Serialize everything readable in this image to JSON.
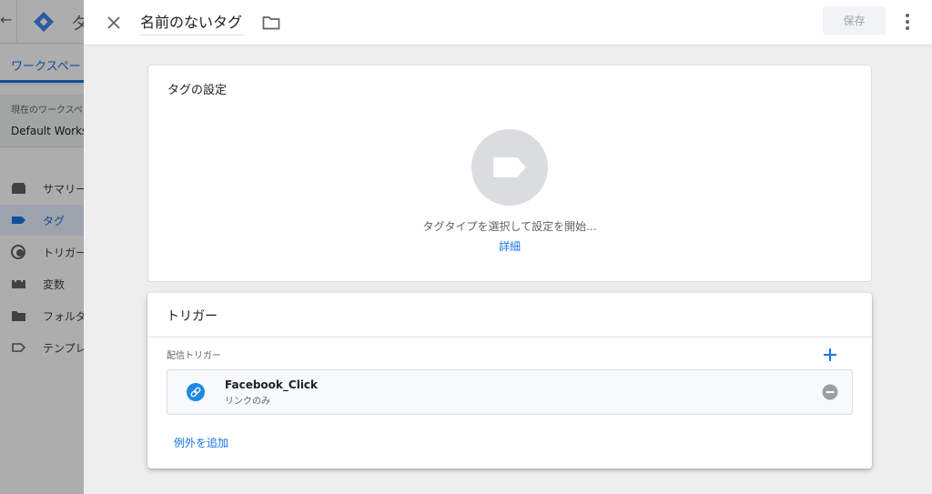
{
  "background": {
    "app_title": "タ",
    "workspace_tab": "ワークスペー",
    "workspace_caption": "現在のワークスペ",
    "workspace_name": "Default Works",
    "nav": [
      {
        "label": "サマリー",
        "icon": "summary-icon"
      },
      {
        "label": "タグ",
        "icon": "tag-icon"
      },
      {
        "label": "トリガー",
        "icon": "trigger-icon"
      },
      {
        "label": "変数",
        "icon": "variables-icon"
      },
      {
        "label": "フォルダ",
        "icon": "folder-icon"
      },
      {
        "label": "テンプレ",
        "icon": "template-icon"
      }
    ]
  },
  "header": {
    "tag_name": "名前のないタグ",
    "save_label": "保存"
  },
  "tag_config": {
    "title": "タグの設定",
    "hint": "タグタイプを選択して設定を開始...",
    "details_link": "詳細"
  },
  "triggering": {
    "title": "トリガー",
    "firing_label": "配信トリガー",
    "trigger": {
      "name": "Facebook_Click",
      "type": "リンクのみ"
    },
    "add_exception": "例外を追加"
  },
  "colors": {
    "accent": "#1a73e8",
    "link_icon_bg": "#1e88e5",
    "disabled_text": "#9aa0a6"
  }
}
